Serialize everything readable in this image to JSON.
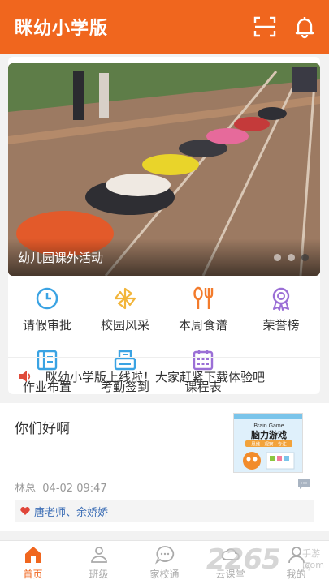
{
  "header": {
    "title": "眯幼小学版",
    "bg_color": "#f0661e",
    "icons": [
      "scan-icon",
      "bell-icon"
    ]
  },
  "banner": {
    "caption": "幼儿园课外活动",
    "slide_count": 3,
    "active_slide": 3
  },
  "grid": {
    "items": [
      {
        "label": "请假审批",
        "icon": "clock-icon",
        "color": "#3aa3e3"
      },
      {
        "label": "校园风采",
        "icon": "pinwheel-icon",
        "color": "#f2b53a"
      },
      {
        "label": "本周食谱",
        "icon": "utensils-icon",
        "color": "#f37b2c"
      },
      {
        "label": "荣誉榜",
        "icon": "medal-icon",
        "color": "#9b6fd6"
      },
      {
        "label": "作业布置",
        "icon": "book-icon",
        "color": "#3aa3e3"
      },
      {
        "label": "考勤签到",
        "icon": "checkin-icon",
        "color": "#3aa3e3"
      },
      {
        "label": "课程表",
        "icon": "calendar-icon",
        "color": "#9b6fd6"
      }
    ]
  },
  "notice": {
    "text": "眯幼小学版上线啦！大家赶紧下载体验吧",
    "icon": "speaker-icon",
    "icon_color": "#e04b3a"
  },
  "post": {
    "title": "你们好啊",
    "author": "林总",
    "time": "04-02 09:47",
    "likes": "唐老师、余娇娇",
    "thumbnail": {
      "line1": "Brain Game",
      "line2": "脑力游戏",
      "line3": "思维 · 观察 · 专注"
    }
  },
  "tabbar": {
    "items": [
      {
        "label": "首页",
        "icon": "home-icon",
        "active": true
      },
      {
        "label": "班级",
        "icon": "class-icon",
        "active": false
      },
      {
        "label": "家校通",
        "icon": "chat-icon",
        "active": false
      },
      {
        "label": "云课堂",
        "icon": "cloud-icon",
        "active": false
      },
      {
        "label": "我的",
        "icon": "user-icon",
        "active": false
      }
    ]
  },
  "watermark": {
    "big": "2265",
    "line1": "手游网",
    "line2": ".com"
  }
}
